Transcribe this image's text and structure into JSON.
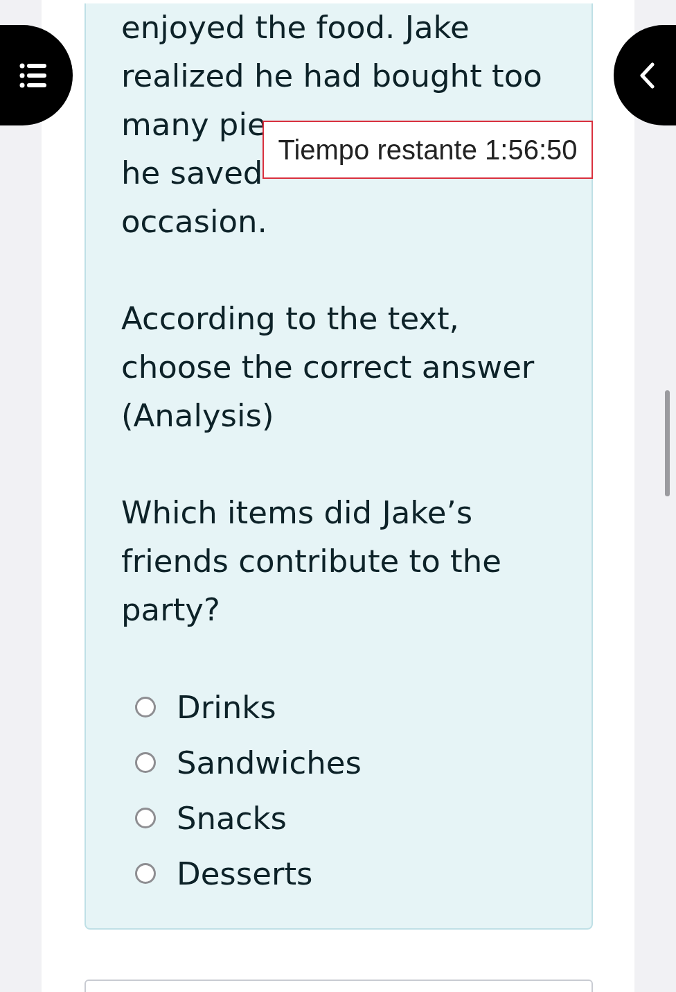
{
  "passage_lines": [
    "enjoyed the food. Jake",
    "realized he had bought too",
    "many pie",
    "he saved",
    "occasion."
  ],
  "instruction": "According to the text, choose the correct answer (Analysis)",
  "question": "Which items did Jake’s friends contribute to the party?",
  "options": [
    {
      "label": "Drinks",
      "selected": false
    },
    {
      "label": "Sandwiches",
      "selected": false
    },
    {
      "label": "Snacks",
      "selected": false
    },
    {
      "label": "Desserts",
      "selected": false
    }
  ],
  "timer": "Tiempo restante 1:56:50"
}
